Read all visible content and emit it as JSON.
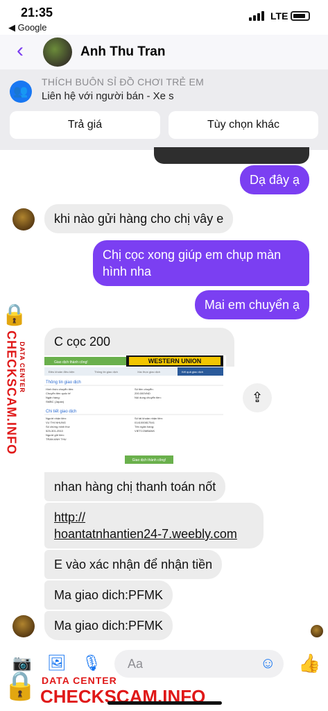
{
  "status_bar": {
    "time": "21:35",
    "back_app": "◀ Google",
    "network": "LTE"
  },
  "header": {
    "contact_name": "Anh Thu Tran"
  },
  "banner": {
    "title": "THÍCH BUÔN SỈ ĐỒ CHƠI TRẺ EM",
    "subtitle": "Liên hệ với người bán - Xe s",
    "buttons": [
      "Trả giá",
      "Tùy chọn khác"
    ]
  },
  "messages": [
    {
      "dir": "out",
      "text": "Dạ đây ạ"
    },
    {
      "dir": "in",
      "text": "khi nào gửi hàng cho chị vây e"
    },
    {
      "dir": "out",
      "text": "Chị cọc xong giúp em chụp màn hình nha"
    },
    {
      "dir": "out",
      "text": "Mai em chuyển ạ"
    },
    {
      "dir": "in",
      "text": "C cọc 200"
    },
    {
      "dir": "in",
      "text": "nhan hàng chị thanh toán nốt"
    },
    {
      "dir": "in",
      "text": "http://hoantatnhantien24-7.weebly.com"
    },
    {
      "dir": "in",
      "text": "E vào xác nhận để nhận tiền"
    },
    {
      "dir": "in",
      "text": "Ma giao dich:PFMK"
    },
    {
      "dir": "in",
      "text": "Ma giao dich:PFMK"
    }
  ],
  "link_lines": [
    "http://",
    "hoantatnhantien24-7.weebly.com"
  ],
  "outgoing_2_lines": [
    "Chị cọc xong giúp em chụp màn",
    "hình nha"
  ],
  "receipt": {
    "status_top": "Giao dịch thành công!",
    "brand": "WESTERN UNION",
    "steps": [
      "Điều khoản điều kiện",
      "Thông tin giao dịch",
      "Xác thực giao dịch",
      "Kết quả giao dịch"
    ],
    "section1": "Thông tin giao dịch",
    "left1": [
      "Hình thức chuyển tiền:",
      "Chuyển tiền quốc tế",
      "Ngân hàng:",
      "SMBC (Japan)"
    ],
    "right1": [
      "Số tiền chuyển:",
      "200.000VND",
      "Nội dung chuyển tiền:"
    ],
    "section2": "Chi tiết giao dịch",
    "left2": [
      "Người nhận tiền:",
      "VU THI NHUNG",
      "Số chứng minh thư:",
      "525-301-2510",
      "Người gửi tiền:",
      "TRAN ANH THU"
    ],
    "right2": [
      "Số tài khoản nhận tiền:",
      "0141000817541",
      "Tên ngân hàng:",
      "VIETCOMBANK"
    ],
    "status_bottom": "Giao dịch thành công!"
  },
  "composer": {
    "placeholder": "Aa"
  },
  "watermark": {
    "label": "DATA CENTER",
    "site": "CHECKSCAM.INFO"
  },
  "icons": [
    "back-chevron-icon",
    "people-icon",
    "share-icon",
    "camera-icon",
    "photo-icon",
    "mic-icon",
    "emoji-icon",
    "like-icon",
    "lock-icon"
  ]
}
